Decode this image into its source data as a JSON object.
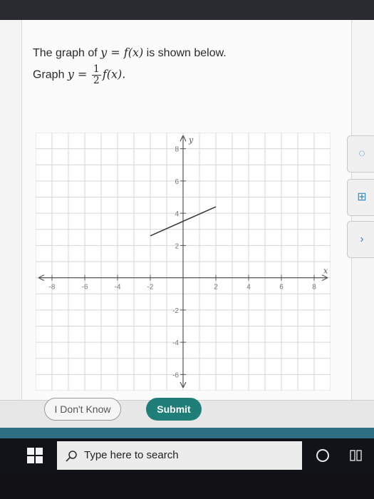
{
  "question": {
    "line1_prefix": "The graph of ",
    "line1_math": "y = f(x)",
    "line1_suffix": " is shown below.",
    "line2_prefix": "Graph ",
    "line2_lhs": "y =",
    "frac_num": "1",
    "frac_den": "2",
    "line2_rhs": "f(x)."
  },
  "graph": {
    "x_label": "x",
    "y_label": "y",
    "x_range": [
      -9,
      9
    ],
    "y_range": [
      -7,
      9
    ],
    "x_ticks": [
      "-8",
      "-6",
      "-4",
      "-2",
      "2",
      "4",
      "6",
      "8"
    ],
    "y_ticks": [
      "8",
      "6",
      "4",
      "2",
      "-2",
      "-4",
      "-6"
    ],
    "segment": {
      "x1": -2,
      "y1": 2.6,
      "x2": 2,
      "y2": 4.4
    }
  },
  "buttons": {
    "dont_know": "I Don't Know",
    "submit": "Submit"
  },
  "taskbar": {
    "search_placeholder": "Type here to search"
  },
  "colors": {
    "submit": "#1f7f78",
    "taskbar": "#101418",
    "accent_strip": "#2f6f83"
  }
}
